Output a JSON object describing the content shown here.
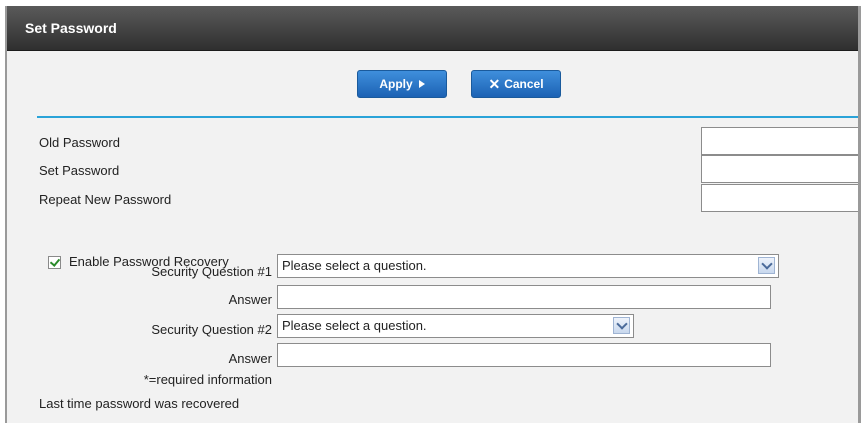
{
  "window": {
    "title": "Set Password"
  },
  "toolbar": {
    "apply_label": "Apply",
    "cancel_label": "Cancel"
  },
  "form": {
    "old_password_label": "Old Password",
    "set_password_label": "Set Password",
    "repeat_password_label": "Repeat New Password",
    "enable_recovery_label": "Enable Password Recovery",
    "enable_recovery_checked": true,
    "question1_label": "Security Question #1",
    "question1_value": "Please select a question.",
    "answer1_label": "Answer",
    "question2_label": "Security Question #2",
    "question2_value": "Please select a question.",
    "answer2_label": "Answer",
    "required_note": "*=required information",
    "last_recovered_label": "Last time password was recovered"
  },
  "colors": {
    "accent": "#2aa3d8",
    "button": "#1c62b4",
    "titlebar": "#3a3a3a"
  }
}
